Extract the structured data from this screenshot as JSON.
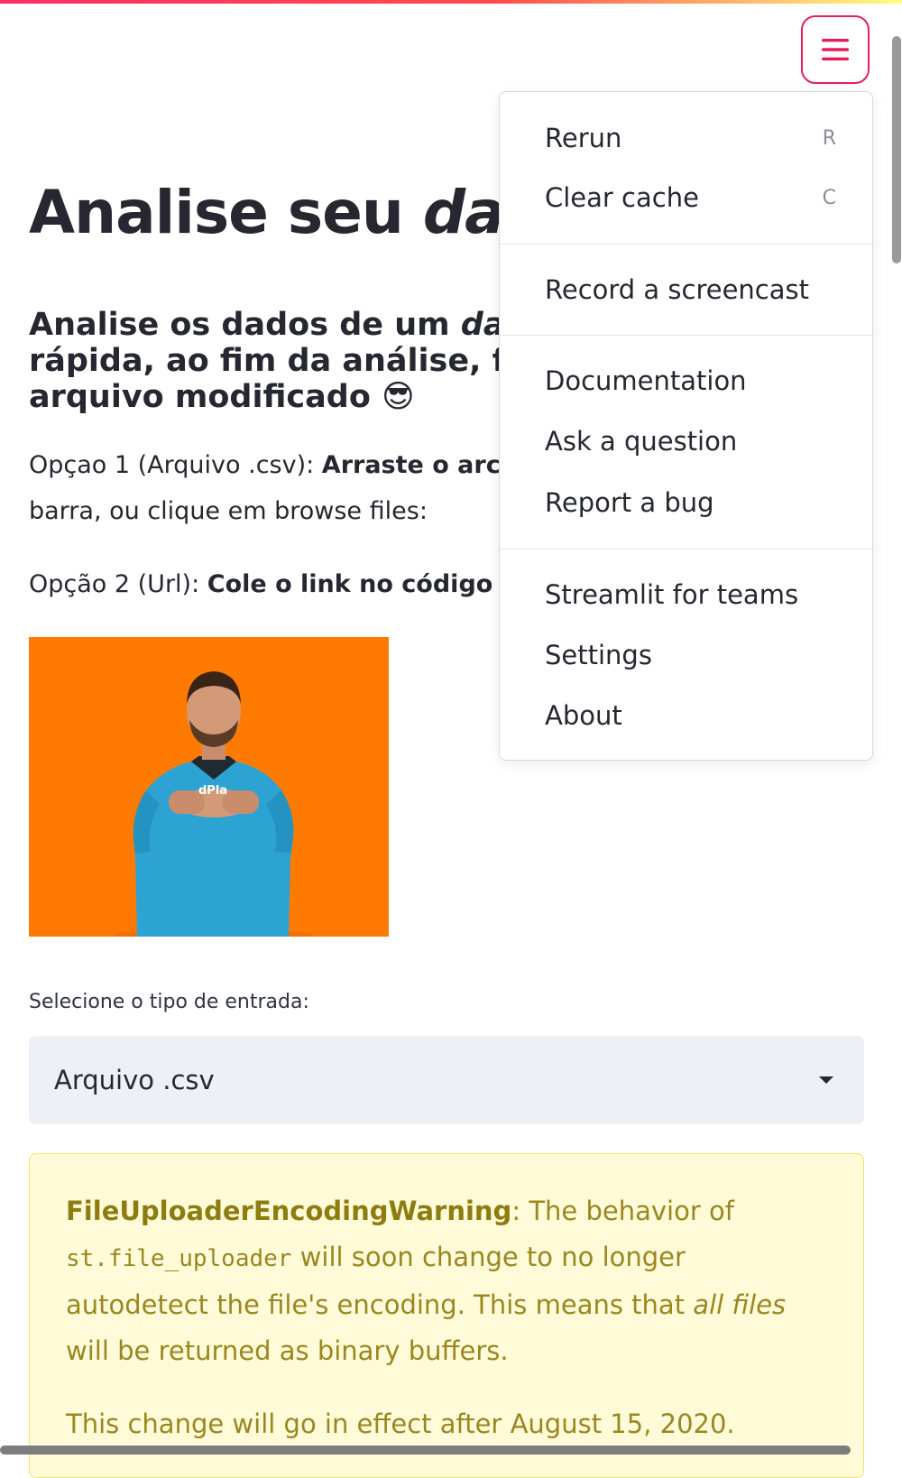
{
  "header": {
    "menu_icon": "hamburger-icon"
  },
  "page": {
    "title_prefix": "Analise seu ",
    "title_em": "dat",
    "subtitle_part1": "Analise os dados de um ",
    "subtitle_em": "data",
    "subtitle_line2": "rápida, ao fim da análise, faç",
    "subtitle_line3": "arquivo modificado ",
    "emoji": "😎",
    "option1_prefix": "Opçao 1 (Arquivo .csv): ",
    "option1_bold": "Arraste o arc",
    "option1_line2": "barra, ou clique em browse files:",
    "option2_prefix": "Opção 2 (Url): ",
    "option2_bold": "Cole o link no código"
  },
  "gif": {
    "shirt_text": "dPla"
  },
  "select": {
    "label": "Selecione o tipo de entrada:",
    "value": "Arquivo .csv"
  },
  "warning": {
    "name": "FileUploaderEncodingWarning",
    "text1": ": The behavior of ",
    "code": "st.file_uploader",
    "text2": " will soon change to no longer autodetect the file's encoding. This means that ",
    "em": "all files",
    "text3": " will be returned as binary buffers.",
    "note": "This change will go in effect after August 15, 2020."
  },
  "menu": {
    "rerun": {
      "label": "Rerun",
      "shortcut": "R"
    },
    "clear_cache": {
      "label": "Clear cache",
      "shortcut": "C"
    },
    "record": "Record a screencast",
    "documentation": "Documentation",
    "ask": "Ask a question",
    "bug": "Report a bug",
    "teams": "Streamlit for teams",
    "settings": "Settings",
    "about": "About"
  },
  "colors": {
    "accent": "#e51f5b",
    "warning_bg": "#fffbd8",
    "warning_text": "#9a8720",
    "select_bg": "#eff0f5",
    "gif_bg": "#ff7a00"
  }
}
